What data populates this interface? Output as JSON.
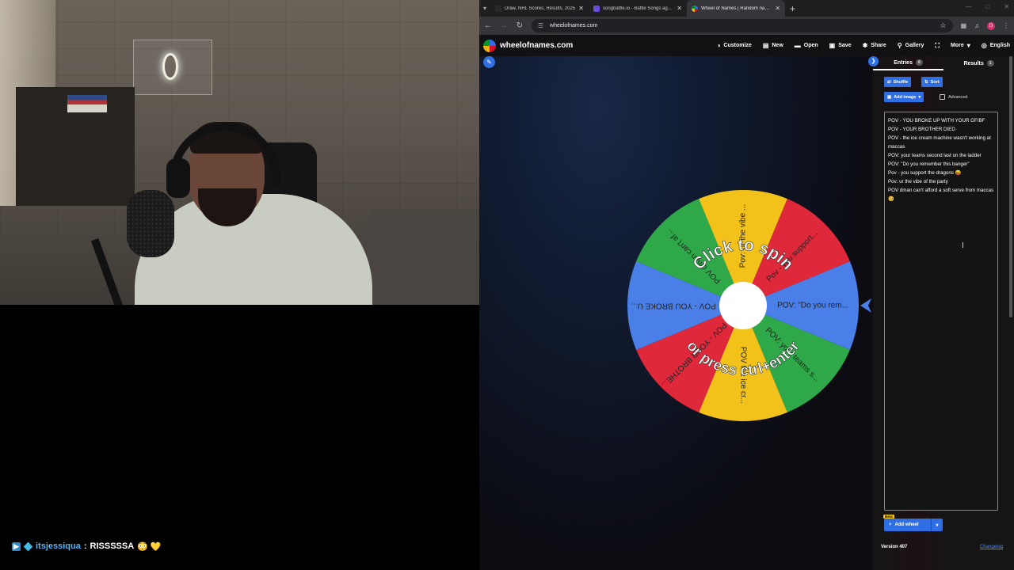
{
  "chat": {
    "username": "itsjessiqua",
    "separator": ":",
    "message": "RISSSSSA",
    "emoji": "😳 💛"
  },
  "browser": {
    "tabs": [
      {
        "label": "Draw, NRL Scores, Results, 2025",
        "favicon_color": "#2a2a2a",
        "active": false
      },
      {
        "label": "songbattle.io - Battle Songs ag...",
        "favicon_color": "#6a4ce0",
        "active": false
      },
      {
        "label": "Wheel of Names | Random nam...",
        "favicon_color": "#3369e8",
        "active": true
      }
    ],
    "new_tab_symbol": "+",
    "url": "wheelofnames.com",
    "profile_initial": "D"
  },
  "header": {
    "brand": "wheelofnames.com",
    "menu": [
      {
        "label": "Customize",
        "icon": "palette-icon",
        "glyph": "◑"
      },
      {
        "label": "New",
        "icon": "new-file-icon",
        "glyph": "▤"
      },
      {
        "label": "Open",
        "icon": "folder-icon",
        "glyph": "▬"
      },
      {
        "label": "Save",
        "icon": "save-icon",
        "glyph": "▣"
      },
      {
        "label": "Share",
        "icon": "share-icon",
        "glyph": "✱"
      },
      {
        "label": "Gallery",
        "icon": "search-icon",
        "glyph": "⚲"
      },
      {
        "label": "",
        "icon": "fullscreen-icon",
        "glyph": "⛶"
      },
      {
        "label": "More",
        "icon": "chevron-down-icon",
        "glyph": "▾"
      },
      {
        "label": "English",
        "icon": "globe-icon",
        "glyph": "◎"
      }
    ]
  },
  "wheel": {
    "center_text_top": "Click to spin",
    "center_text_bottom": "or press ctrl+enter",
    "colors": {
      "green": "#2fa84a",
      "yellow": "#f2c21b",
      "red": "#e0283b",
      "blue": "#4a7fe8"
    },
    "segments": [
      {
        "label": "POV: \"Do you rem...",
        "color": "blue"
      },
      {
        "label": "POV: your teams s...",
        "color": "green"
      },
      {
        "label": "POV  the ice cr...",
        "color": "yellow"
      },
      {
        "label": "POV - YOUR BROTHE...",
        "color": "red"
      },
      {
        "label": "POV - YOU BROKE U...",
        "color": "blue"
      },
      {
        "label": "POV dman can't af...",
        "color": "green"
      },
      {
        "label": "Pov: ur the vibe ...",
        "color": "yellow"
      },
      {
        "label": "Pov - you support...",
        "color": "red"
      }
    ]
  },
  "panel": {
    "tab_entries": "Entries",
    "entries_count": "8",
    "tab_results": "Results",
    "results_count": "1",
    "shuffle_label": "Shuffle",
    "sort_label": "Sort",
    "add_image_label": "Add image",
    "advanced_label": "Advanced",
    "entries": [
      "POV - YOU BROKE UP WITH YOUR GF/BF",
      "POV - YOUR BROTHER DIED",
      "POV -  the ice cream machine wasn't working at maccas",
      "POV: your teams second last on the ladder",
      " POV: \"Do you remember this banger\"",
      "Pov - you support the dragons 😝",
      "Pov: ur the vibe of the party",
      "POV dman can't afford a soft serve from maccas 🥺"
    ],
    "beta_label": "Beta",
    "add_wheel_label": "Add wheel",
    "version_label": "Version 407",
    "changelog_label": "Changelog"
  }
}
